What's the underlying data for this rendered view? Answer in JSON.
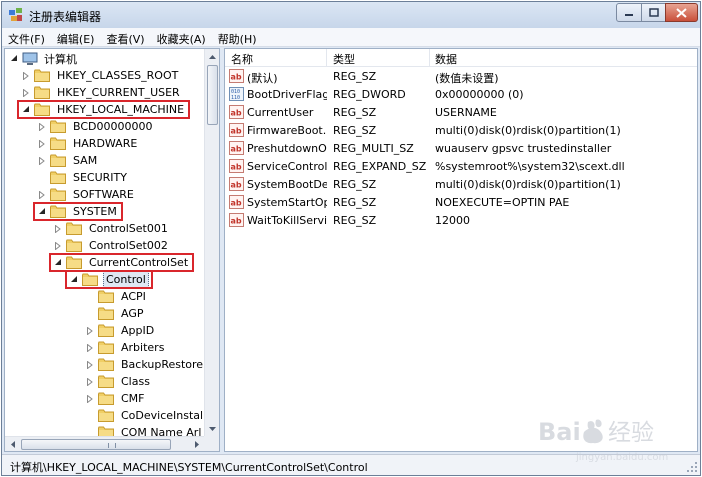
{
  "window": {
    "title": "注册表编辑器"
  },
  "menu": [
    "文件(F)",
    "编辑(E)",
    "查看(V)",
    "收藏夹(A)",
    "帮助(H)"
  ],
  "tree": {
    "root_label": "计算机",
    "items": [
      {
        "label": "HKEY_CLASSES_ROOT",
        "state": "collapsed"
      },
      {
        "label": "HKEY_CURRENT_USER",
        "state": "collapsed"
      },
      {
        "label": "HKEY_LOCAL_MACHINE",
        "state": "expanded",
        "highlight": true
      },
      {
        "label": "BCD00000000",
        "state": "collapsed"
      },
      {
        "label": "HARDWARE",
        "state": "collapsed"
      },
      {
        "label": "SAM",
        "state": "collapsed"
      },
      {
        "label": "SECURITY",
        "state": "leaf"
      },
      {
        "label": "SOFTWARE",
        "state": "collapsed"
      },
      {
        "label": "SYSTEM",
        "state": "expanded",
        "highlight": true
      },
      {
        "label": "ControlSet001",
        "state": "collapsed"
      },
      {
        "label": "ControlSet002",
        "state": "collapsed"
      },
      {
        "label": "CurrentControlSet",
        "state": "expanded",
        "highlight": true
      },
      {
        "label": "Control",
        "state": "expanded",
        "highlight": true,
        "selected": true
      },
      {
        "label": "ACPI",
        "state": "leaf"
      },
      {
        "label": "AGP",
        "state": "leaf"
      },
      {
        "label": "AppID",
        "state": "collapsed"
      },
      {
        "label": "Arbiters",
        "state": "collapsed"
      },
      {
        "label": "BackupRestore",
        "state": "collapsed"
      },
      {
        "label": "Class",
        "state": "collapsed"
      },
      {
        "label": "CMF",
        "state": "collapsed"
      },
      {
        "label": "CoDeviceInstall",
        "state": "leaf"
      },
      {
        "label": "COM Name Arl",
        "state": "leaf"
      }
    ]
  },
  "list": {
    "headers": {
      "name": "名称",
      "type": "类型",
      "data": "数据"
    },
    "rows": [
      {
        "name": "(默认)",
        "type": "REG_SZ",
        "data": "(数值未设置)",
        "icon": "string-value-icon"
      },
      {
        "name": "BootDriverFlags",
        "type": "REG_DWORD",
        "data": "0x00000000 (0)",
        "icon": "binary-value-icon"
      },
      {
        "name": "CurrentUser",
        "type": "REG_SZ",
        "data": "USERNAME",
        "icon": "string-value-icon"
      },
      {
        "name": "FirmwareBoot...",
        "type": "REG_SZ",
        "data": "multi(0)disk(0)rdisk(0)partition(1)",
        "icon": "string-value-icon"
      },
      {
        "name": "PreshutdownO...",
        "type": "REG_MULTI_SZ",
        "data": "wuauserv gpsvc trustedinstaller",
        "icon": "string-value-icon"
      },
      {
        "name": "ServiceControl...",
        "type": "REG_EXPAND_SZ",
        "data": "%systemroot%\\system32\\scext.dll",
        "icon": "string-value-icon"
      },
      {
        "name": "SystemBootDe...",
        "type": "REG_SZ",
        "data": "multi(0)disk(0)rdisk(0)partition(1)",
        "icon": "string-value-icon"
      },
      {
        "name": "SystemStartOp...",
        "type": "REG_SZ",
        "data": " NOEXECUTE=OPTIN  PAE",
        "icon": "string-value-icon"
      },
      {
        "name": "WaitToKillServi...",
        "type": "REG_SZ",
        "data": "12000",
        "icon": "string-value-icon"
      }
    ]
  },
  "status": {
    "path": "计算机\\HKEY_LOCAL_MACHINE\\SYSTEM\\CurrentControlSet\\Control"
  },
  "watermark": {
    "brand": "Baidu",
    "text": "经验",
    "url": "jingyan.baidu.com"
  },
  "colors": {
    "highlight_box": "#d9262c",
    "folder": "#e8c04a",
    "selection": "#dfe8f4"
  }
}
